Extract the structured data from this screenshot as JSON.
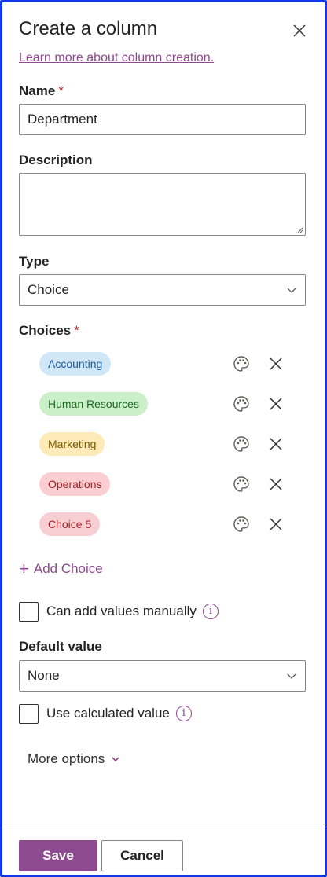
{
  "panel": {
    "title": "Create a column",
    "learn_more": "Learn more about column creation."
  },
  "fields": {
    "name_label": "Name",
    "required_mark": "*",
    "name_value": "Department",
    "description_label": "Description",
    "description_value": "",
    "type_label": "Type",
    "type_value": "Choice",
    "choices_label": "Choices",
    "add_choice": "Add Choice",
    "add_values_manually": "Can add values manually",
    "default_label": "Default value",
    "default_value": "None",
    "use_calculated": "Use calculated value",
    "more_options": "More options"
  },
  "choices": [
    {
      "label": "Accounting",
      "bg": "#d0e7f8",
      "fg": "#1f5a96"
    },
    {
      "label": "Human Resources",
      "bg": "#caefc9",
      "fg": "#1f6a22"
    },
    {
      "label": "Marketing",
      "bg": "#fdeab8",
      "fg": "#7a5800"
    },
    {
      "label": "Operations",
      "bg": "#fbcfd2",
      "fg": "#a4262c"
    },
    {
      "label": "Choice 5",
      "bg": "#f7cfd3",
      "fg": "#a4262c"
    }
  ],
  "footer": {
    "save": "Save",
    "cancel": "Cancel"
  },
  "colors": {
    "accent": "#8e4a8e",
    "frame": "#1436e6",
    "required": "#a4262c"
  },
  "icons": {
    "close": "close-icon",
    "chevron": "chevron-down-icon",
    "palette": "palette-icon",
    "remove": "remove-icon",
    "info": "info-icon",
    "plus": "plus-icon"
  }
}
